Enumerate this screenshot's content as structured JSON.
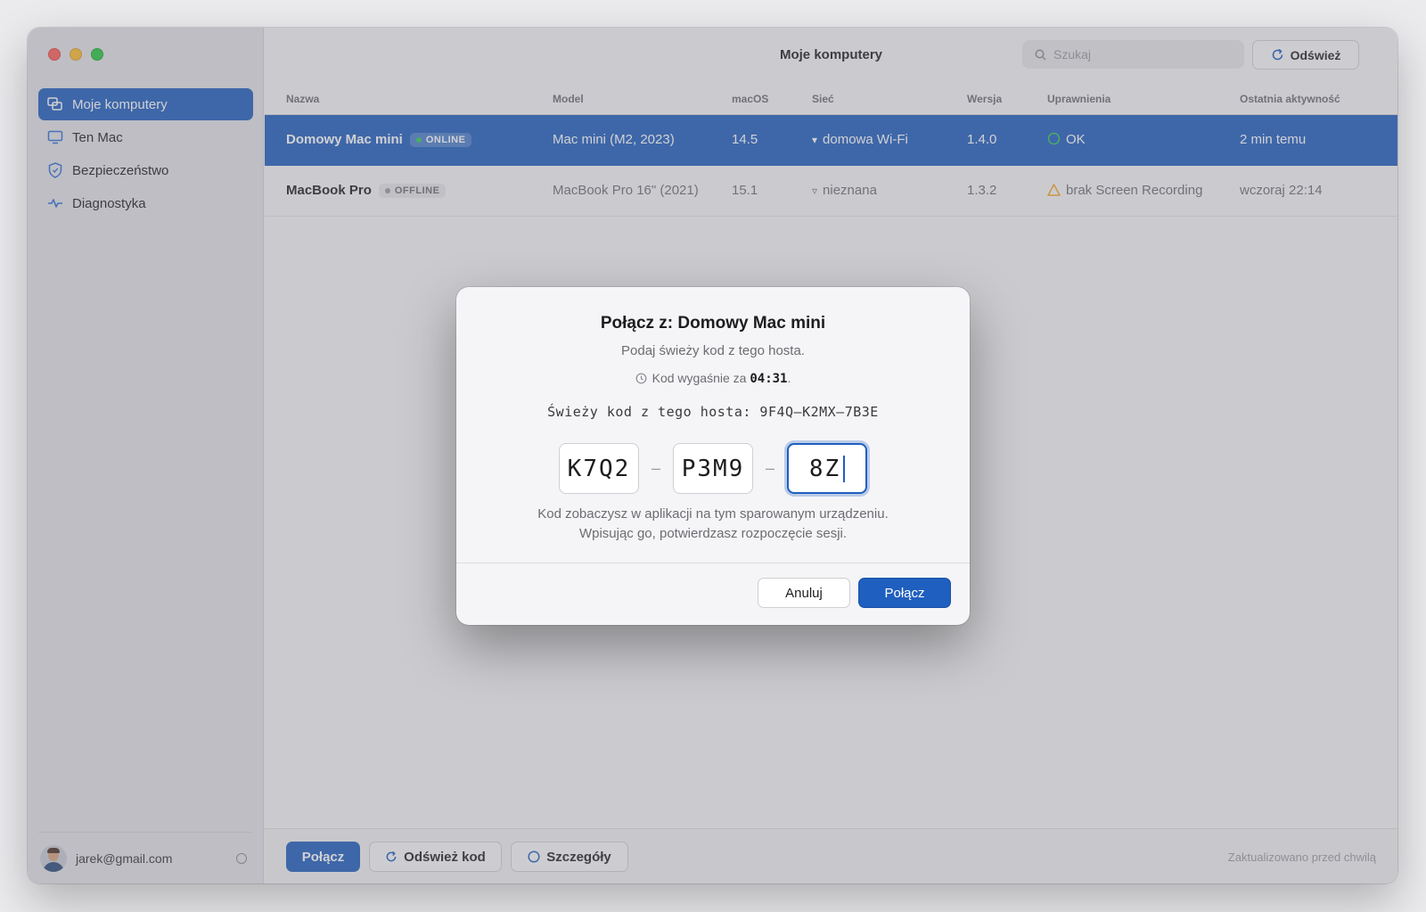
{
  "window": {
    "title": "Moje komputery"
  },
  "sidebar": {
    "items": [
      {
        "label": "Moje komputery",
        "icon": "computers-icon",
        "active": true
      },
      {
        "label": "Ten Mac",
        "icon": "monitor-icon",
        "active": false
      },
      {
        "label": "Bezpieczeństwo",
        "icon": "shield-icon",
        "active": false
      },
      {
        "label": "Diagnostyka",
        "icon": "pulse-icon",
        "active": false
      }
    ],
    "footer": {
      "email": "jarek@gmail.com"
    }
  },
  "toolbar": {
    "search_placeholder": "Szukaj",
    "refresh_label": "Odśwież"
  },
  "table": {
    "headers": [
      "Nazwa",
      "Model",
      "macOS",
      "Sieć",
      "Wersja",
      "Uprawnienia",
      "Ostatnia aktywność"
    ],
    "rows": [
      {
        "name": "Domowy Mac mini",
        "status": "ONLINE",
        "model": "Mac mini (M2, 2023)",
        "macos": "14.5",
        "network": "domowa Wi-Fi",
        "version": "1.4.0",
        "permissions": "OK",
        "last_active": "2 min temu"
      },
      {
        "name": "MacBook Pro",
        "status": "OFFLINE",
        "model": "MacBook Pro 16\" (2021)",
        "macos": "15.1",
        "network": "nieznana",
        "version": "1.3.2",
        "permissions": "brak Screen Recording",
        "last_active": "wczoraj 22:14"
      }
    ]
  },
  "bottombar": {
    "connect_label": "Połącz",
    "refresh_code_label": "Odśwież kod",
    "details_label": "Szczegóły",
    "status": "Zaktualizowano przed chwilą"
  },
  "dialog": {
    "title": "Połącz z: Domowy Mac mini",
    "subtitle": "Podaj świeży kod z tego hosta.",
    "timer_prefix": "Kod wygaśnie za",
    "timer_value": "04:31",
    "timer_suffix": ".",
    "host_code_line": "Świeży kod z tego hosta: 9F4Q–K2MX–7B3E",
    "code_segments": [
      "K7Q2",
      "P3M9",
      "8Z"
    ],
    "separator": "–",
    "help_line1": "Kod zobaczysz w aplikacji na tym sparowanym urządzeniu.",
    "help_line2": "Wpisując go, potwierdzasz rozpoczęcie sesji.",
    "cancel_label": "Anuluj",
    "connect_label": "Połącz"
  },
  "colors": {
    "accent": "#1f5fbf",
    "online": "#34c759",
    "warning": "#f5a623"
  }
}
